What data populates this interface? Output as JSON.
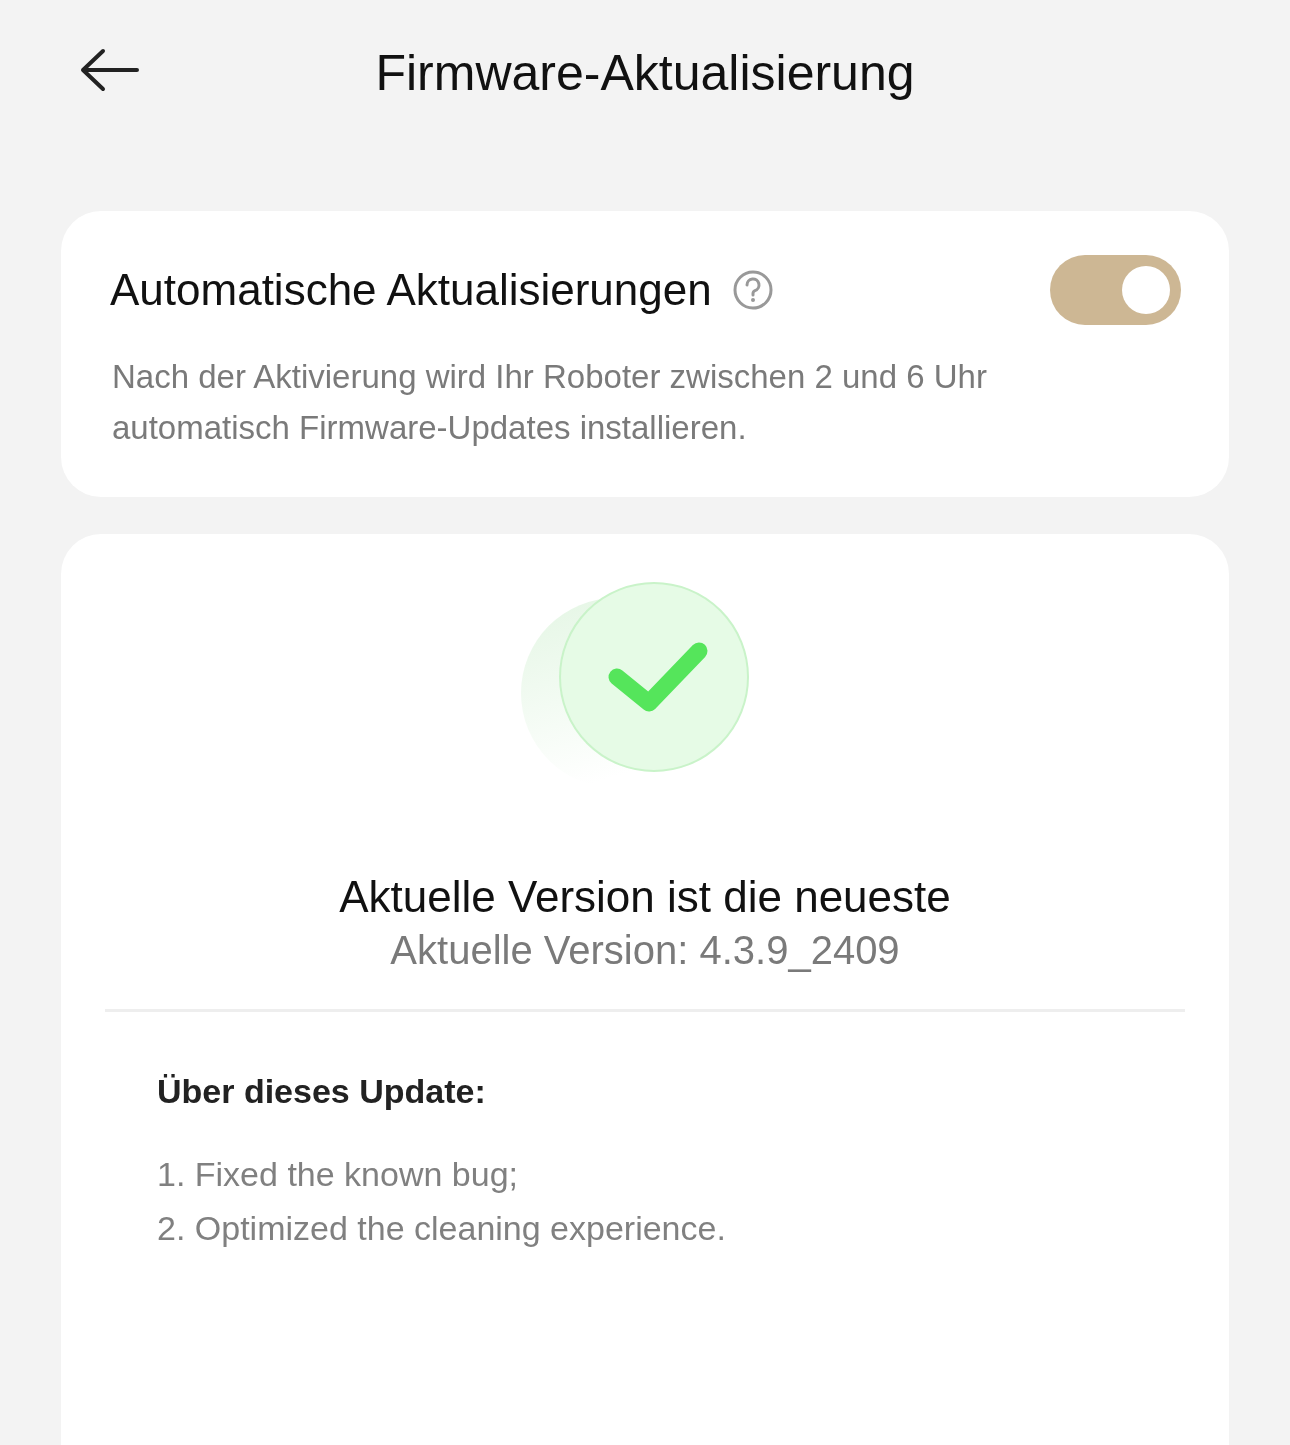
{
  "header": {
    "title": "Firmware-Aktualisierung"
  },
  "auto_update": {
    "title": "Automatische Aktualisierungen",
    "on": true,
    "description": "Nach der Aktivierung wird Ihr Roboter zwischen 2 und 6 Uhr automatisch Firmware-Updates installieren."
  },
  "status": {
    "title": "Aktuelle Version ist die neueste",
    "version": "Aktuelle Version: 4.3.9_2409"
  },
  "release_notes": {
    "heading": "Über dieses Update:",
    "items": [
      "1. Fixed the known bug;",
      "2. Optimized the cleaning experience."
    ]
  }
}
